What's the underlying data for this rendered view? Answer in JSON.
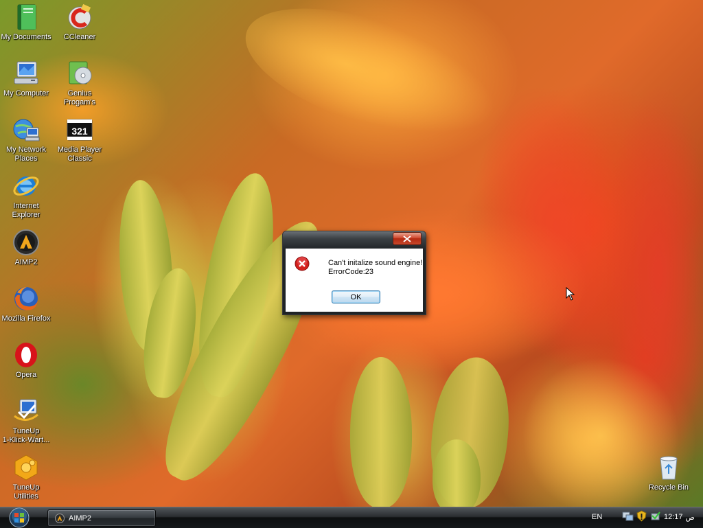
{
  "desktop": {
    "icons_left": [
      {
        "label": "My Documents",
        "icon": "my-documents-icon"
      },
      {
        "label": "My Computer",
        "icon": "my-computer-icon"
      },
      {
        "label": "My Network\nPlaces",
        "icon": "network-places-icon"
      },
      {
        "label": "Internet\nExplorer",
        "icon": "internet-explorer-icon"
      },
      {
        "label": "AIMP2",
        "icon": "aimp2-icon"
      },
      {
        "label": "Mozilla Firefox",
        "icon": "firefox-icon"
      },
      {
        "label": "Opera",
        "icon": "opera-icon"
      },
      {
        "label": "TuneUp\n1-Klick-Wart...",
        "icon": "tuneup-icon"
      },
      {
        "label": "TuneUp Utilities",
        "icon": "tuneup-utilities-icon"
      }
    ],
    "icons_col2": [
      {
        "label": "CCleaner",
        "icon": "ccleaner-icon"
      },
      {
        "label": "Genius\nProgam's",
        "icon": "genius-programs-icon"
      },
      {
        "label": "Media Player\nClassic",
        "icon": "media-player-classic-icon"
      }
    ],
    "recycle_bin": {
      "label": "Recycle Bin",
      "icon": "recycle-bin-icon"
    }
  },
  "dialog": {
    "message_line1": "Can't initalize sound engine!",
    "message_line2": "ErrorCode:23",
    "ok_label": "OK",
    "icon": "error-icon"
  },
  "taskbar": {
    "start_icon": "windows-orb-icon",
    "task_label": "AIMP2",
    "language": "EN",
    "clock_time": "12:17",
    "clock_ampm": "ص",
    "tray_icons": [
      "network-icon",
      "security-alert-icon",
      "safely-remove-icon"
    ]
  },
  "colors": {
    "taskbar_top": "#51565a",
    "taskbar_bottom": "#0d0f10",
    "close_button": "#d2492f",
    "ok_button_border": "#3c7fb1"
  }
}
